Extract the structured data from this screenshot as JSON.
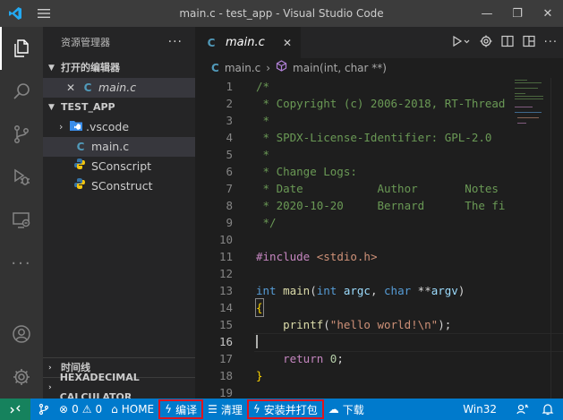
{
  "window": {
    "title": "main.c - test_app - Visual Studio Code",
    "controls": {
      "minimize": "—",
      "restore": "❐",
      "close": "✕"
    }
  },
  "activitybar": {
    "items": [
      "explorer-icon",
      "search-icon",
      "source-control-icon",
      "debug-icon",
      "remote-explorer-icon",
      "more-icon"
    ],
    "bottom": [
      "account-icon",
      "settings-gear-icon"
    ],
    "more": "···"
  },
  "sidebar": {
    "header": "资源管理器",
    "more": "···",
    "open_editors": {
      "title": "打开的编辑器",
      "items": [
        {
          "close": "✕",
          "icon": "C",
          "label": "main.c"
        }
      ]
    },
    "project": {
      "title": "TEST_APP",
      "items": [
        {
          "label": ".vscode",
          "type": "folder"
        },
        {
          "label": "main.c",
          "type": "c",
          "icon": "C"
        },
        {
          "label": "SConscript",
          "type": "python"
        },
        {
          "label": "SConstruct",
          "type": "python"
        }
      ]
    },
    "timeline": "时间线",
    "hex_calc": "HEXADECIMAL CALCULATOR"
  },
  "editor": {
    "tab": {
      "icon": "C",
      "label": "main.c",
      "close": "✕"
    },
    "breadcrumb": {
      "file": "main.c",
      "sep": "›",
      "symbol": "main(int, char **)"
    },
    "line_numbers": [
      "1",
      "2",
      "3",
      "4",
      "5",
      "6",
      "7",
      "8",
      "9",
      "10",
      "11",
      "12",
      "13",
      "14",
      "15",
      "16",
      "17",
      "18",
      "19"
    ],
    "current_line": "16"
  },
  "statusbar": {
    "errors": "0",
    "warnings": "0",
    "home": "HOME",
    "build": "编译",
    "clean": "清理",
    "install": "安装并打包",
    "download": "下载",
    "platform": "Win32"
  },
  "colors": {
    "accent": "#007acc",
    "highlight_border": "#e0141e",
    "remote": "#16825d"
  }
}
